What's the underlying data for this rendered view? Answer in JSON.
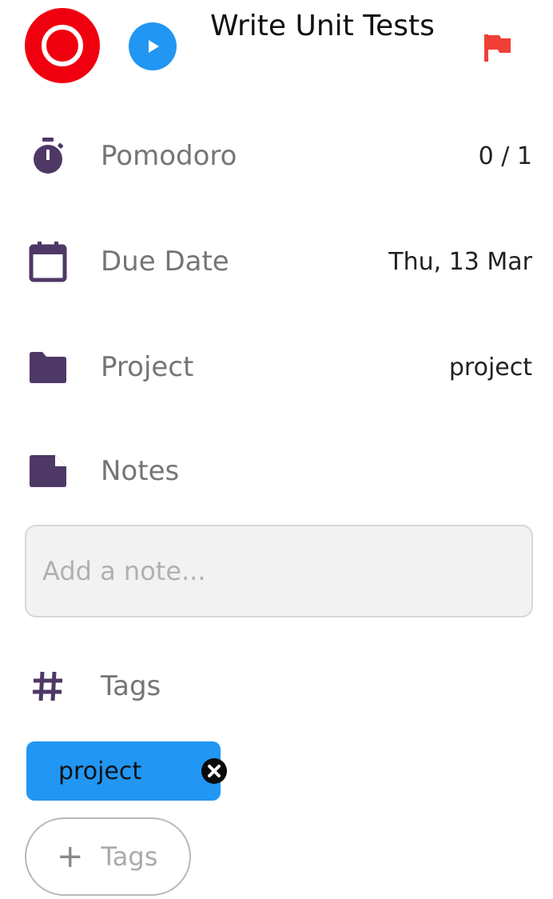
{
  "task": {
    "title": "Write Unit Tests"
  },
  "header": {
    "complete_icon": "circle-ring-icon",
    "play_icon": "play-icon",
    "flag_icon": "flag-icon",
    "flag_color": "#ef3f36"
  },
  "details": {
    "pomodoro": {
      "label": "Pomodoro",
      "value": "0 / 1",
      "icon": "stopwatch-icon"
    },
    "due_date": {
      "label": "Due Date",
      "value": "Thu, 13 Mar",
      "icon": "calendar-icon"
    },
    "project": {
      "label": "Project",
      "value": "project",
      "icon": "folder-icon"
    },
    "notes": {
      "label": "Notes",
      "icon": "note-icon",
      "placeholder": "Add a note..."
    }
  },
  "tags": {
    "label": "Tags",
    "icon": "hash-icon",
    "items": [
      {
        "label": "project"
      }
    ],
    "add_label": "Tags"
  },
  "colors": {
    "accent": "#2196f3",
    "danger": "#f0000f",
    "icon": "#4e3866"
  }
}
